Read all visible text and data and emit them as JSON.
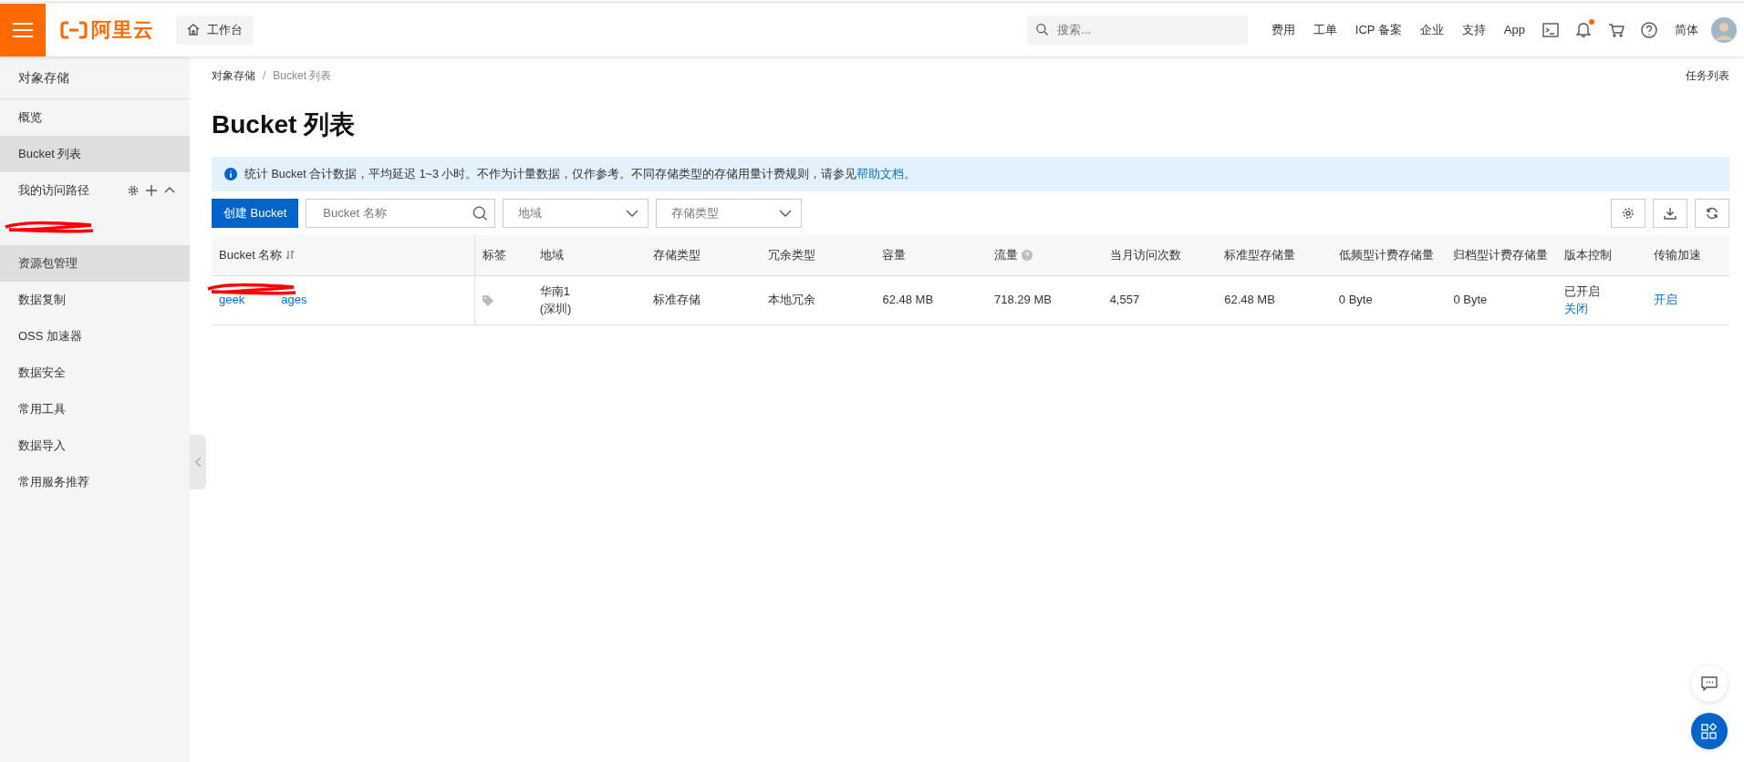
{
  "topbar": {
    "logo": "阿里云",
    "workbench": "工作台",
    "search": {
      "placeholder": "搜索..."
    },
    "links": [
      "费用",
      "工单",
      "ICP 备案",
      "企业",
      "支持",
      "App"
    ],
    "notification_unread": true,
    "language": "简体"
  },
  "sidebar": {
    "title": "对象存储",
    "items": [
      {
        "kind": "item",
        "label": "概览",
        "selected": false
      },
      {
        "kind": "item",
        "label": "Bucket 列表",
        "selected": true
      },
      {
        "kind": "group",
        "label": "我的访问路径",
        "expanded": true,
        "children": [
          {
            "redacted": true
          }
        ]
      },
      {
        "kind": "item",
        "label": "资源包管理",
        "selected": true
      },
      {
        "kind": "item",
        "label": "数据复制",
        "selected": false
      },
      {
        "kind": "item",
        "label": "OSS 加速器",
        "selected": false
      },
      {
        "kind": "item",
        "label": "数据安全",
        "selected": false
      },
      {
        "kind": "item",
        "label": "常用工具",
        "selected": false
      },
      {
        "kind": "item",
        "label": "数据导入",
        "selected": false
      },
      {
        "kind": "item",
        "label": "常用服务推荐",
        "selected": false
      }
    ]
  },
  "main": {
    "breadcrumb": [
      "对象存储",
      "Bucket 列表"
    ],
    "breadcrumb_separator": "/",
    "task_link": "任务列表",
    "title": "Bucket 列表",
    "notice": "统计 Bucket 合计数据，平均延迟 1~3 小时。不作为计量数据，仅作参考。不同存储类型的存储用量计费规则，请参见",
    "notice_link": "帮助文档",
    "notice_end": "。",
    "create_button": "创建 Bucket",
    "name_search": {
      "placeholder": "Bucket 名称"
    },
    "filters": [
      "地域",
      "存储类型"
    ],
    "table": {
      "columns": [
        {
          "label": "Bucket 名称",
          "sortable": true
        },
        {
          "label": "标签"
        },
        {
          "label": "地域"
        },
        {
          "label": "存储类型"
        },
        {
          "label": "冗余类型"
        },
        {
          "label": "容量"
        },
        {
          "label": "流量",
          "help": true
        },
        {
          "label": "当月访问次数"
        },
        {
          "label": "标准型存储量"
        },
        {
          "label": "低频型计费存储量"
        },
        {
          "label": "归档型计费存储量"
        },
        {
          "label": "版本控制"
        },
        {
          "label": "传输加速"
        }
      ],
      "rows": [
        {
          "cells": [
            {
              "kind": "redacted-link",
              "start": "geek",
              "end": "ages"
            },
            {
              "kind": "tag"
            },
            {
              "kind": "lines",
              "lines": [
                "华南1",
                "(深圳)"
              ]
            },
            {
              "kind": "text",
              "text": "标准存储"
            },
            {
              "kind": "text",
              "text": "本地冗余"
            },
            {
              "kind": "text",
              "text": "62.48 MB"
            },
            {
              "kind": "text",
              "text": "718.29 MB"
            },
            {
              "kind": "text",
              "text": "4,557"
            },
            {
              "kind": "text",
              "text": "62.48 MB"
            },
            {
              "kind": "text",
              "text": "0 Byte"
            },
            {
              "kind": "text",
              "text": "0 Byte"
            },
            {
              "kind": "status-link",
              "text": "已开启",
              "link": "关闭"
            },
            {
              "kind": "link",
              "text": "开启"
            }
          ]
        }
      ]
    }
  }
}
